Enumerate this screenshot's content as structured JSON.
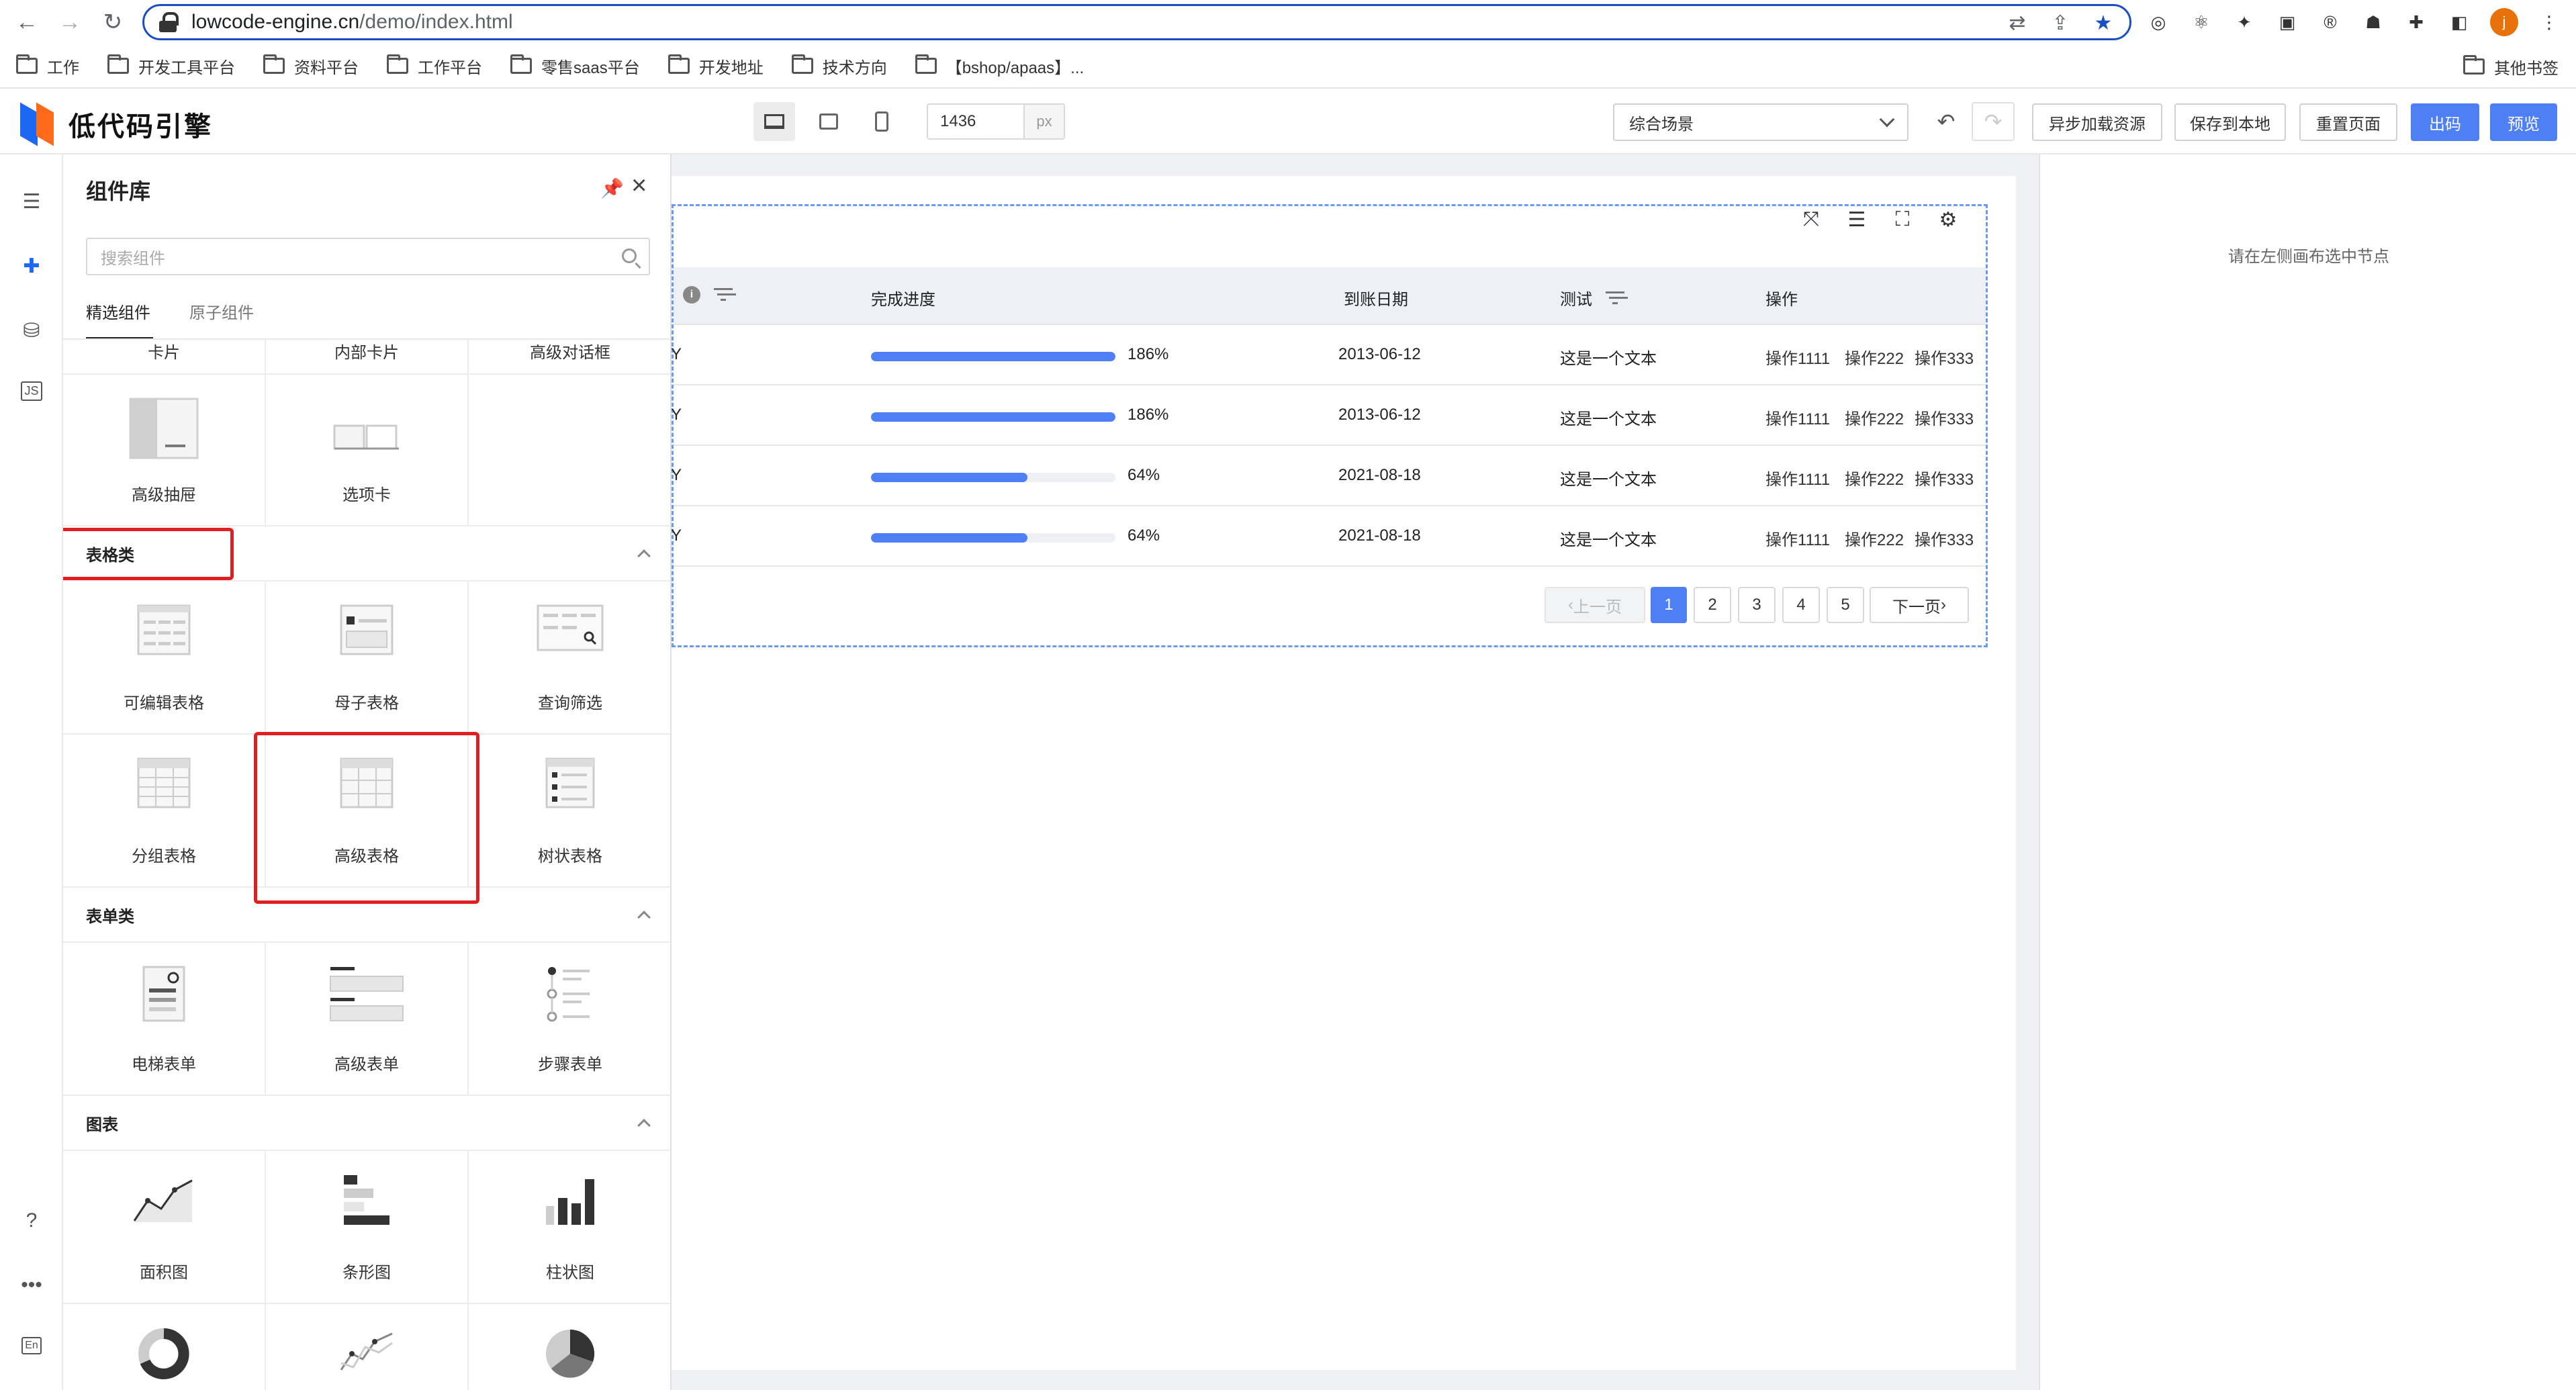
{
  "browser": {
    "url_host": "lowcode-engine.cn",
    "url_path": "/demo/index.html",
    "bookmarks": [
      "工作",
      "开发工具平台",
      "资料平台",
      "工作平台",
      "零售saas平台",
      "开发地址",
      "技术方向",
      "【bshop/apaas】..."
    ],
    "other_bookmarks": "其他书签",
    "avatar_letter": "j"
  },
  "topbar": {
    "logo_text": "低代码引擎",
    "canvas_width": "1436",
    "canvas_unit": "px",
    "scene": "综合场景",
    "buttons": {
      "async_load": "异步加载资源",
      "save_local": "保存到本地",
      "reset_page": "重置页面",
      "export_code": "出码",
      "preview": "预览"
    }
  },
  "panel": {
    "title": "组件库",
    "search_placeholder": "搜索组件",
    "tabs": [
      "精选组件",
      "原子组件"
    ],
    "partial_row": [
      "卡片",
      "内部卡片",
      "高级对话框"
    ],
    "row_layout": [
      "高级抽屉",
      "选项卡"
    ],
    "sections": [
      {
        "title": "表格类",
        "items": [
          "可编辑表格",
          "母子表格",
          "查询筛选",
          "分组表格",
          "高级表格",
          "树状表格"
        ]
      },
      {
        "title": "表单类",
        "items": [
          "电梯表单",
          "高级表单",
          "步骤表单"
        ]
      },
      {
        "title": "图表",
        "items": [
          "面积图",
          "条形图",
          "柱状图"
        ]
      }
    ]
  },
  "table": {
    "columns": [
      "完成进度",
      "到账日期",
      "测试",
      "操作"
    ],
    "rows": [
      {
        "cut": "Y",
        "progress": 1.0,
        "percent": "186%",
        "date": "2013-06-12",
        "text": "这是一个文本",
        "actions": [
          "操作1111",
          "操作222",
          "操作333"
        ]
      },
      {
        "cut": "Y",
        "progress": 1.0,
        "percent": "186%",
        "date": "2013-06-12",
        "text": "这是一个文本",
        "actions": [
          "操作1111",
          "操作222",
          "操作333"
        ]
      },
      {
        "cut": "Y",
        "progress": 0.64,
        "percent": "64%",
        "date": "2021-08-18",
        "text": "这是一个文本",
        "actions": [
          "操作1111",
          "操作222",
          "操作333"
        ]
      },
      {
        "cut": "Y",
        "progress": 0.64,
        "percent": "64%",
        "date": "2021-08-18",
        "text": "这是一个文本",
        "actions": [
          "操作1111",
          "操作222",
          "操作333"
        ]
      }
    ],
    "pagination": {
      "prev": "上一页",
      "pages": [
        "1",
        "2",
        "3",
        "4",
        "5"
      ],
      "next": "下一页",
      "current": "1"
    }
  },
  "right_panel": {
    "hint": "请在左侧画布选中节点"
  },
  "colors": {
    "accent": "#4e7ff5",
    "highlight_box": "#e02020",
    "logo_blue": "#1c68f5",
    "logo_orange": "#ff6a1a"
  }
}
